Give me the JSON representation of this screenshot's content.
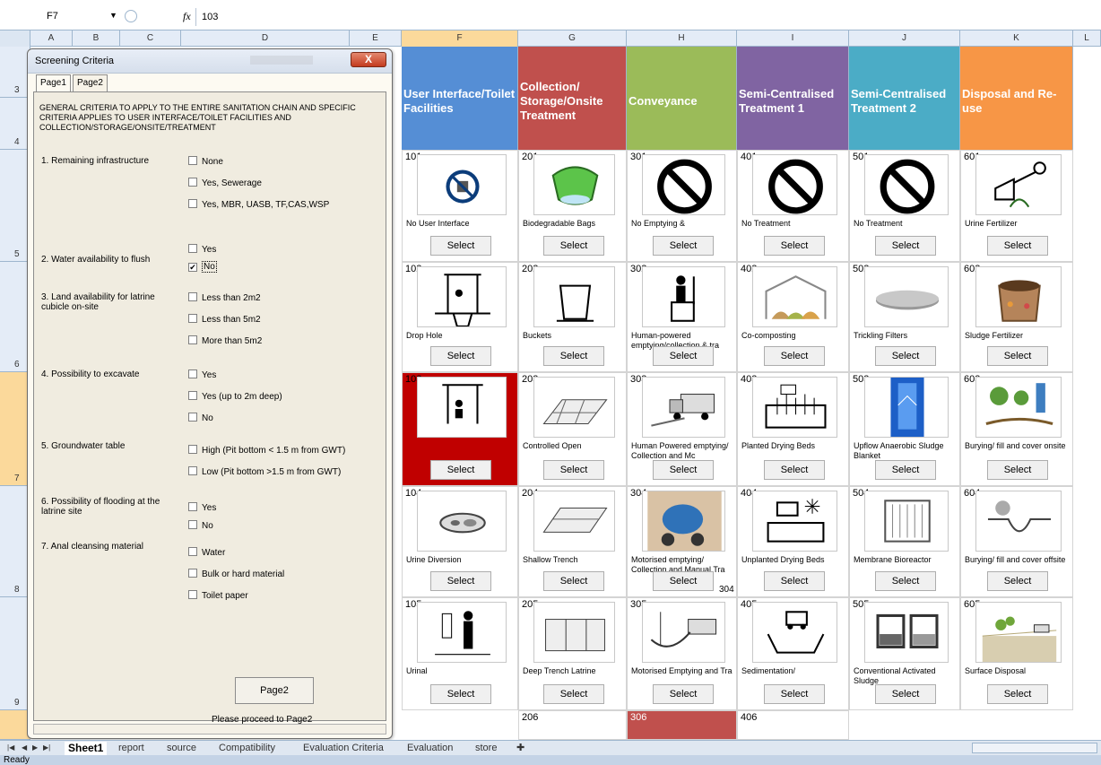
{
  "formula_bar": {
    "name_box": "F7",
    "fx_label": "fx",
    "value": "103"
  },
  "columns": [
    "A",
    "B",
    "C",
    "D",
    "E",
    "F",
    "G",
    "H",
    "I",
    "J",
    "K",
    "L"
  ],
  "rows": [
    "3",
    "4",
    "5",
    "6",
    "7",
    "8",
    "9"
  ],
  "headers": [
    {
      "label": "User Interface/Toilet Facilities",
      "color": "#558ed5"
    },
    {
      "label": "Collection/ Storage/Onsite Treatment",
      "color": "#c0504d"
    },
    {
      "label": "Conveyance",
      "color": "#9bbb59"
    },
    {
      "label": "Semi-Centralised Treatment 1",
      "color": "#8064a2"
    },
    {
      "label": "Semi-Centralised Treatment 2",
      "color": "#4bacc6"
    },
    {
      "label": "Disposal and Re-use",
      "color": "#f79646"
    }
  ],
  "select_label": "Select",
  "options": [
    [
      {
        "num": "101",
        "label": "No User Interface",
        "icon": "no-toilet-icon"
      },
      {
        "num": "102",
        "label": "Drop Hole",
        "icon": "drop-hole-icon"
      },
      {
        "num": "103",
        "label": "",
        "icon": "toilet-shelter-icon",
        "highlight": "#c00000"
      },
      {
        "num": "104",
        "label": "Urine Diversion",
        "icon": "urine-diversion-icon"
      },
      {
        "num": "105",
        "label": "Urinal",
        "icon": "urinal-icon"
      }
    ],
    [
      {
        "num": "201",
        "label": "Biodegradable Bags",
        "icon": "bag-icon"
      },
      {
        "num": "202",
        "label": "Buckets",
        "icon": "bucket-icon"
      },
      {
        "num": "203",
        "label": "Controlled Open",
        "icon": "open-trench-icon"
      },
      {
        "num": "204",
        "label": "Shallow Trench",
        "icon": "shallow-trench-icon"
      },
      {
        "num": "205",
        "label": "Deep Trench Latrine",
        "icon": "deep-trench-icon"
      }
    ],
    [
      {
        "num": "301",
        "label": "No Emptying &",
        "icon": "no-entry-icon"
      },
      {
        "num": "302",
        "label": "Human-powered emptying/collection & tra",
        "icon": "manual-emptying-icon"
      },
      {
        "num": "303",
        "label": "Human Powered emptying/ Collection and Mc",
        "icon": "truck-icon"
      },
      {
        "num": "304",
        "label": "Motorised emptying/ Collection and Manual Tra",
        "icon": "vacuum-tanker-icon"
      },
      {
        "num": "305",
        "label": "Motorised Emptying and Tra",
        "icon": "sewer-truck-icon"
      }
    ],
    [
      {
        "num": "401",
        "label": "No Treatment",
        "icon": "no-entry-icon"
      },
      {
        "num": "402",
        "label": "Co-composting",
        "icon": "compost-icon"
      },
      {
        "num": "403",
        "label": "Planted Drying Beds",
        "icon": "planted-bed-icon"
      },
      {
        "num": "404",
        "label": "Unplanted Drying Beds",
        "icon": "unplanted-bed-icon"
      },
      {
        "num": "405",
        "label": "Sedimentation/",
        "icon": "sedimentation-icon"
      }
    ],
    [
      {
        "num": "501",
        "label": "No Treatment",
        "icon": "no-entry-icon"
      },
      {
        "num": "502",
        "label": "Trickling Filters",
        "icon": "trickling-filter-icon"
      },
      {
        "num": "503",
        "label": "Upflow Anaerobic Sludge Blanket",
        "icon": "uasb-icon"
      },
      {
        "num": "504",
        "label": "Membrane Bioreactor",
        "icon": "mbr-icon"
      },
      {
        "num": "505",
        "label": "Conventional Activated Sludge",
        "icon": "activated-sludge-icon"
      }
    ],
    [
      {
        "num": "601",
        "label": "Urine Fertilizer",
        "icon": "watering-can-icon"
      },
      {
        "num": "602",
        "label": "Sludge Fertilizer",
        "icon": "sludge-bag-icon"
      },
      {
        "num": "603",
        "label": "Burying/ fill and cover onsite",
        "icon": "tree-planting-icon"
      },
      {
        "num": "604",
        "label": "Burying/ fill and cover offsite",
        "icon": "pit-icon"
      },
      {
        "num": "605",
        "label": "Surface Disposal",
        "icon": "field-icon"
      }
    ]
  ],
  "bottom_row": [
    {
      "num": "206"
    },
    {
      "num": "306"
    },
    {
      "num": "406"
    }
  ],
  "extra_label_304": "304",
  "dialog": {
    "title": "Screening Criteria",
    "tabs": [
      "Page1",
      "Page2"
    ],
    "intro": "GENERAL CRITERIA TO APPLY TO THE ENTIRE SANITATION CHAIN AND SPECIFIC CRITERIA APPLIES TO USER INTERFACE/TOILET FACILITIES AND COLLECTION/STORAGE/ONSITE/TREATMENT",
    "criteria": [
      {
        "label": "1. Remaining infrastructure",
        "options": [
          {
            "text": "None",
            "checked": false
          },
          {
            "text": "Yes, Sewerage",
            "checked": false
          },
          {
            "text": "Yes, MBR, UASB, TF,CAS,WSP",
            "checked": false
          }
        ]
      },
      {
        "label": "2. Water availability to flush",
        "options": [
          {
            "text": "Yes",
            "checked": false
          },
          {
            "text": "No",
            "checked": true
          }
        ]
      },
      {
        "label": "3. Land availability for latrine cubicle on-site",
        "options": [
          {
            "text": "Less than 2m2",
            "checked": false
          },
          {
            "text": "Less than 5m2",
            "checked": false
          },
          {
            "text": "More than 5m2",
            "checked": false
          }
        ]
      },
      {
        "label": "4. Possibility to excavate",
        "options": [
          {
            "text": "Yes",
            "checked": false
          },
          {
            "text": "Yes (up to 2m deep)",
            "checked": false
          },
          {
            "text": "No",
            "checked": false
          }
        ]
      },
      {
        "label": "5. Groundwater table",
        "options": [
          {
            "text": "High (Pit bottom < 1.5 m from GWT)",
            "checked": false
          },
          {
            "text": "Low (Pit bottom >1.5 m from GWT)",
            "checked": false
          }
        ]
      },
      {
        "label": "6. Possibility of flooding at the latrine site",
        "options": [
          {
            "text": "Yes",
            "checked": false
          },
          {
            "text": "No",
            "checked": false
          }
        ]
      },
      {
        "label": "7. Anal cleansing material",
        "options": [
          {
            "text": "Water",
            "checked": false
          },
          {
            "text": "Bulk or hard material",
            "checked": false
          },
          {
            "text": "Toilet paper",
            "checked": false
          }
        ]
      }
    ],
    "next_button": "Page2",
    "proceed_text": "Please proceed to Page2",
    "close_label": "X"
  },
  "sheet_tabs": [
    "Sheet1",
    "report",
    "source",
    "Compatibility",
    "Evaluation Criteria",
    "Evaluation",
    "store"
  ],
  "active_sheet": "Sheet1",
  "status": "Ready"
}
